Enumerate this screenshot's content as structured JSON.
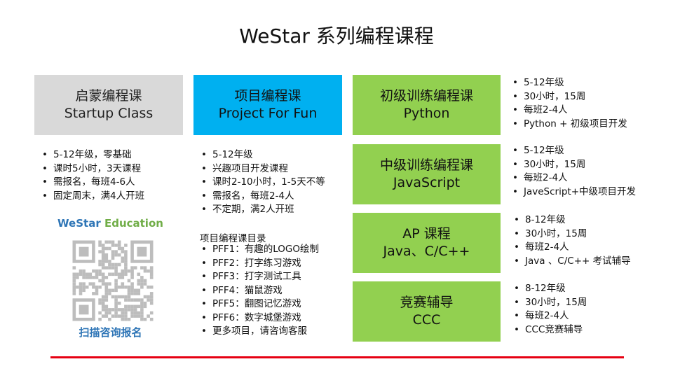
{
  "title": "WeStar 系列编程课程",
  "courses": {
    "startup": {
      "line1": "启蒙编程课",
      "line2": "Startup Class",
      "bullets": [
        "5-12年级，零基础",
        "课时5小时，3天课程",
        "需报名，每班4-6人",
        "固定周末，满4人开班"
      ]
    },
    "project": {
      "line1": "项目编程课",
      "line2": "Project For Fun",
      "bullets": [
        "5-12年级",
        "兴趣项目开发课程",
        "课时2-10小时，1-5天不等",
        "需报名，每班2-4人",
        "不定期，满2人开班"
      ],
      "catalog_title": "项目编程课目录",
      "catalog": [
        "PFF1：有趣的LOGO绘制",
        "PFF2：打字练习游戏",
        "PFF3：打字测试工具",
        "PFF4：猫鼠游戏",
        "PFF5：翻图记忆游戏",
        "PFF6：数字城堡游戏",
        "更多项目，请咨询客服"
      ]
    },
    "python": {
      "line1": "初级训练编程课",
      "line2": "Python",
      "bullets": [
        "5-12年级",
        "30小时，15周",
        "每班2-4人",
        "Python + 初级项目开发"
      ]
    },
    "javascript": {
      "line1": "中级训练编程课",
      "line2": "JavaScript",
      "bullets": [
        "5-12年级",
        "30小时，15周",
        "每班2-4人",
        "JaveScript+中级项目开发"
      ]
    },
    "ap": {
      "line1": "AP 课程",
      "line2": "Java、C/C++",
      "bullets": [
        "8-12年级",
        "30小时，15周",
        "每班2-4人",
        "Java 、C/C++ 考试辅导"
      ]
    },
    "ccc": {
      "line1": "竞赛辅导",
      "line2": "CCC",
      "bullets": [
        "8-12年级",
        "30小时，15周",
        "每班2-4人",
        "CCC竞赛辅导"
      ]
    }
  },
  "brand": {
    "we": "WeStar",
    "rest": " Education"
  },
  "qr_caption": "扫描咨询报名",
  "colors": {
    "gray_box": "#d9d9d9",
    "blue_box": "#00b0f0",
    "green_box": "#92d050",
    "red_line": "#e60012",
    "brand_blue": "#2e75b6",
    "brand_green": "#70ad47"
  },
  "icons": {
    "qr": "qr-code-icon"
  }
}
